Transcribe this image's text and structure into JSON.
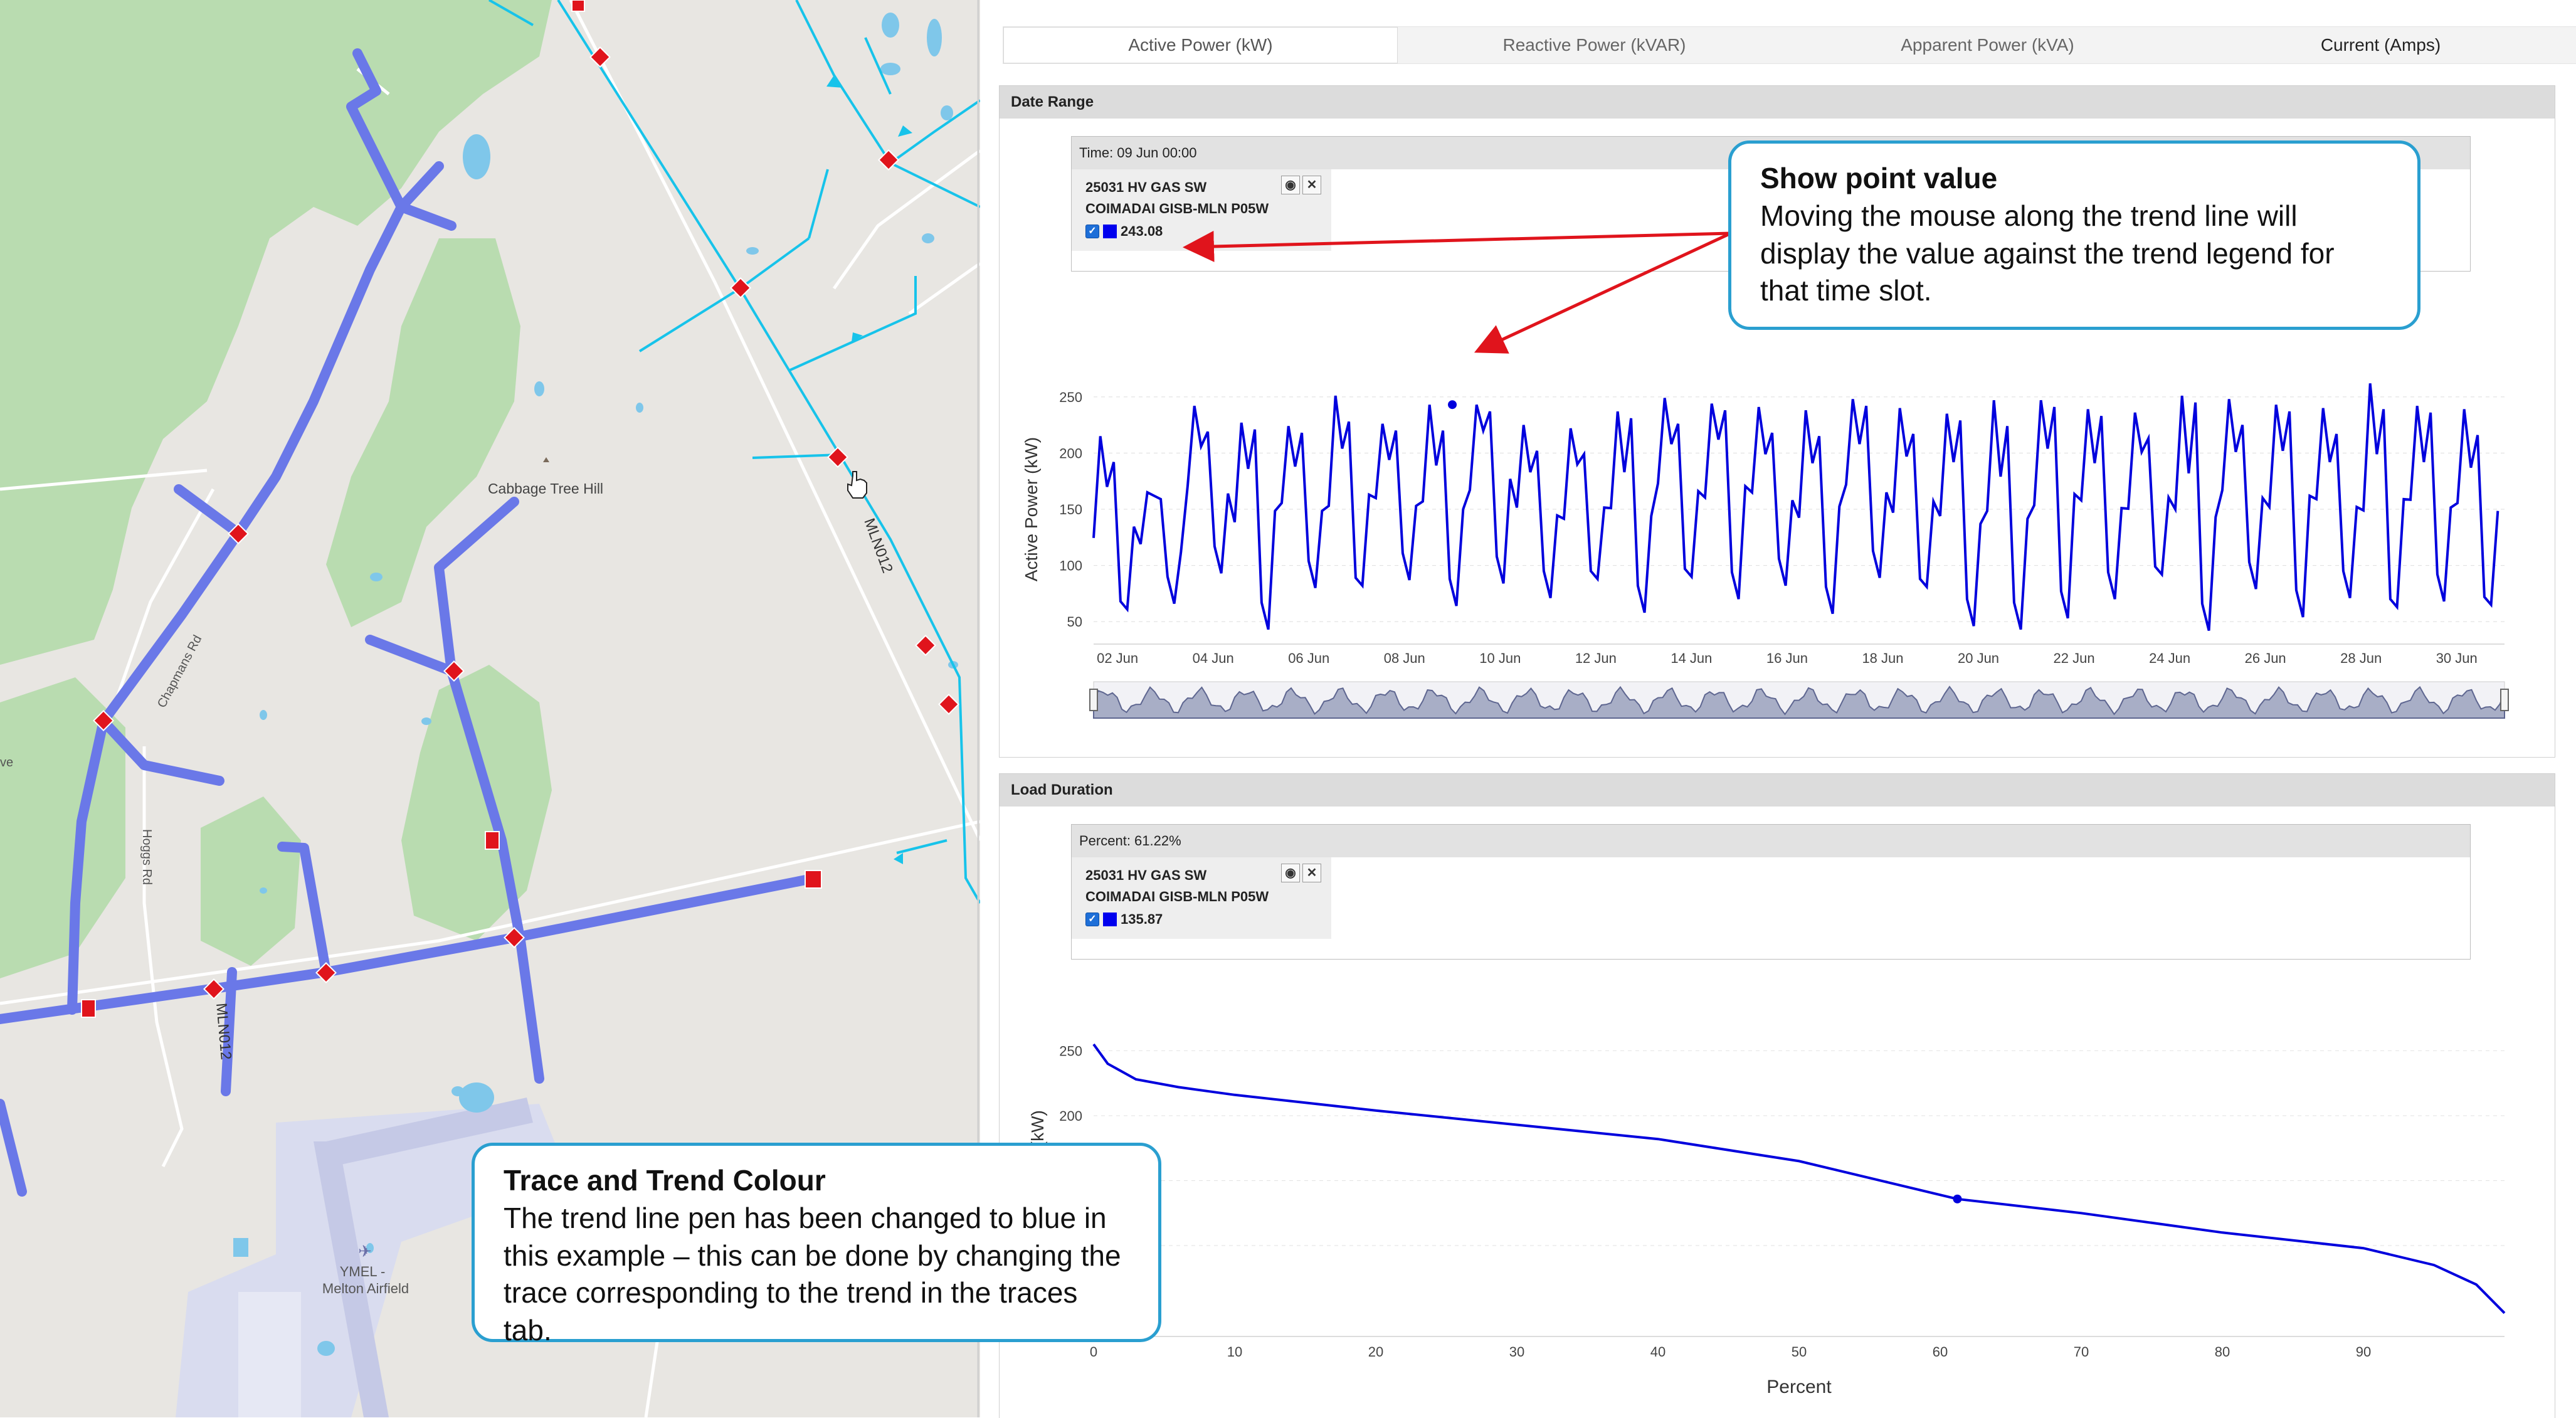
{
  "map": {
    "place_label": "Cabbage Tree Hill",
    "road_chapmans": "Chapmans Rd",
    "road_hoggs": "Hoggs Rd",
    "feeder_label_1": "MLN012",
    "feeder_label_2": "MLN012",
    "airfield_code": "YMEL -",
    "airfield_name": "Melton Airfield",
    "edge_label": "ve"
  },
  "tabs": [
    {
      "label": "Active Power (kW)",
      "active": true
    },
    {
      "label": "Reactive Power (kVAR)",
      "active": false
    },
    {
      "label": "Apparent Power (kVA)",
      "active": false
    },
    {
      "label": "Current (Amps)",
      "active": false
    }
  ],
  "date_range": {
    "panel_title": "Date Range",
    "header": "Time: 09 Jun 00:00",
    "legend_line1": "25031 HV GAS SW",
    "legend_line2": "COIMADAI GISB-MLN P05W",
    "legend_value": "243.08",
    "ylabel": "Active Power (kW)"
  },
  "load_duration": {
    "panel_title": "Load Duration",
    "header": "Percent: 61.22%",
    "legend_line1": "25031 HV GAS SW",
    "legend_line2": "COIMADAI GISB-MLN P05W",
    "legend_value": "135.87",
    "ylabel_visible": "(kW)",
    "xlabel": "Percent"
  },
  "callout_point": {
    "title": "Show point value",
    "body": "Moving the mouse along the trend line will display the value against the trend legend for that time slot."
  },
  "callout_trace": {
    "title": "Trace and Trend Colour",
    "body": "The trend line pen has been changed to blue in this example – this can be done by changing the trace corresponding to the trend in the traces tab."
  },
  "colors": {
    "trend_line": "#0000dd",
    "callout_border": "#2a9fd0",
    "arrow": "#e0141c",
    "feeder_highlight": "#6a78e8",
    "feeder_cyan": "#17c3ea"
  },
  "chart_data": [
    {
      "type": "line",
      "ylabel": "Active Power (kW)",
      "y_ticks": [
        50,
        100,
        150,
        200,
        250
      ],
      "ylim": [
        30,
        270
      ],
      "x_ticks": [
        "02 Jun",
        "04 Jun",
        "06 Jun",
        "08 Jun",
        "10 Jun",
        "12 Jun",
        "14 Jun",
        "16 Jun",
        "18 Jun",
        "20 Jun",
        "22 Jun",
        "24 Jun",
        "26 Jun",
        "28 Jun",
        "30 Jun"
      ],
      "x_range_days": [
        1.5,
        31
      ],
      "highlight_point": {
        "date": "09 Jun 00:00",
        "value": 243.08
      },
      "grid": "horizontal dashed",
      "series": [
        {
          "values_note_daily_peaks": [
            210,
            170,
            240,
            235,
            225,
            245,
            230,
            240,
            250,
            225,
            215,
            240,
            245,
            250,
            240,
            230,
            250,
            235,
            240,
            245,
            255,
            240,
            230,
            255,
            245,
            250,
            240,
            255,
            245,
            235
          ],
          "daily_troughs": [
            55,
            70,
            90,
            50,
            80,
            75,
            90,
            60,
            90,
            70,
            80,
            60,
            85,
            75,
            80,
            65,
            90,
            75,
            50,
            40,
            60,
            70,
            85,
            45,
            75,
            60,
            70,
            55,
            70,
            60
          ]
        }
      ]
    },
    {
      "type": "line",
      "xlabel": "Percent",
      "x_ticks": [
        0,
        10,
        20,
        30,
        40,
        50,
        60,
        70,
        80,
        90
      ],
      "xlim": [
        0,
        100
      ],
      "y_ticks": [
        200,
        250
      ],
      "ylim": [
        30,
        270
      ],
      "highlight_point": {
        "x": 61.22,
        "y": 135.87
      },
      "series": [
        {
          "x": [
            0,
            1,
            3,
            6,
            10,
            20,
            30,
            40,
            50,
            61.22,
            70,
            80,
            90,
            95,
            98,
            100
          ],
          "y": [
            255,
            240,
            228,
            222,
            216,
            204,
            193,
            182,
            165,
            135.87,
            125,
            110,
            98,
            85,
            70,
            48
          ]
        }
      ]
    }
  ]
}
